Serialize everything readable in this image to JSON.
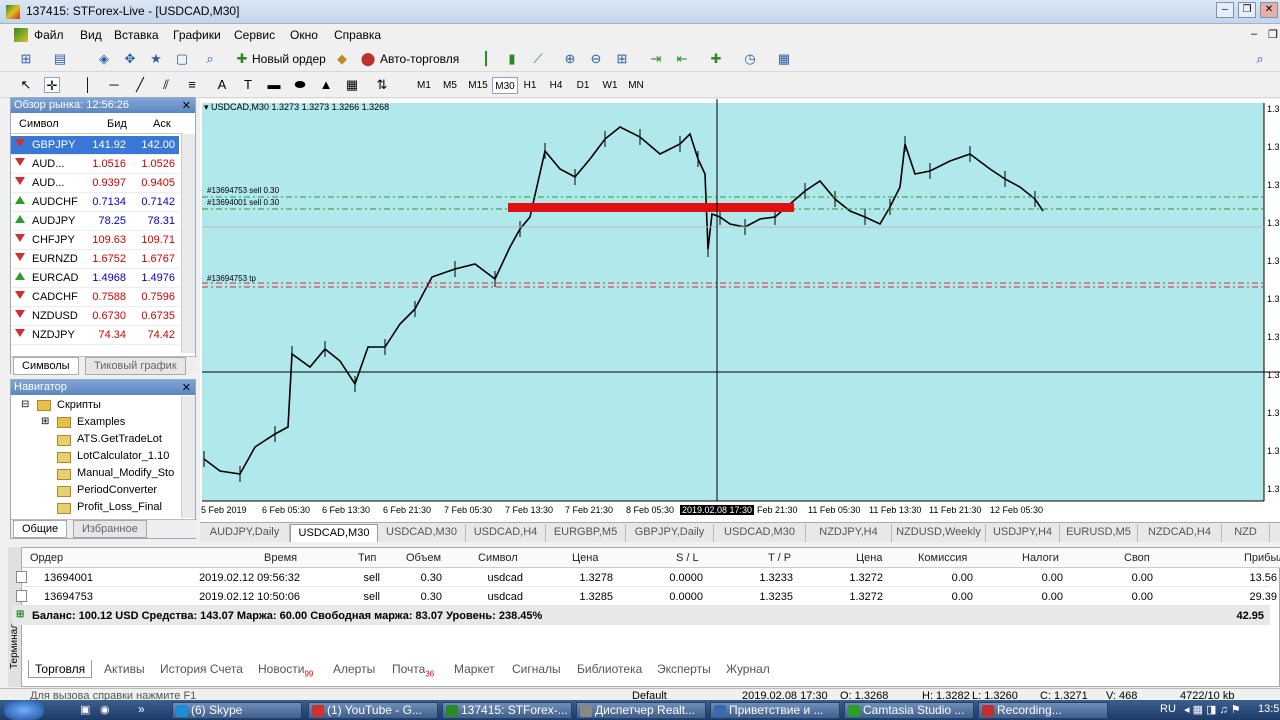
{
  "window": {
    "title": "137415: STForex-Live - [USDCAD,M30]",
    "btn_min": "–",
    "btn_max": "❐",
    "btn_close": "✕"
  },
  "menu": [
    "Файл",
    "Вид",
    "Вставка",
    "Графики",
    "Сервис",
    "Окно",
    "Справка"
  ],
  "toolbar": {
    "new_order": "Новый ордер",
    "auto_trading": "Авто-торговля"
  },
  "timeframes": [
    "M1",
    "M5",
    "M15",
    "M30",
    "H1",
    "H4",
    "D1",
    "W1",
    "MN"
  ],
  "timeframe_active": "M30",
  "market_watch": {
    "title": "Обзор рынка: 12:56:26",
    "col_symbol": "Символ",
    "col_bid": "Бид",
    "col_ask": "Аск",
    "rows": [
      {
        "symbol": "GBPJPY",
        "bid": "141.92",
        "ask": "142.00",
        "dir": "down",
        "selected": true
      },
      {
        "symbol": "AUD...",
        "bid": "1.0516",
        "ask": "1.0526",
        "dir": "down"
      },
      {
        "symbol": "AUD...",
        "bid": "0.9397",
        "ask": "0.9405",
        "dir": "down"
      },
      {
        "symbol": "AUDCHF",
        "bid": "0.7134",
        "ask": "0.7142",
        "dir": "up"
      },
      {
        "symbol": "AUDJPY",
        "bid": "78.25",
        "ask": "78.31",
        "dir": "up"
      },
      {
        "symbol": "CHFJPY",
        "bid": "109.63",
        "ask": "109.71",
        "dir": "down"
      },
      {
        "symbol": "EURNZD",
        "bid": "1.6752",
        "ask": "1.6767",
        "dir": "down"
      },
      {
        "symbol": "EURCAD",
        "bid": "1.4968",
        "ask": "1.4976",
        "dir": "up"
      },
      {
        "symbol": "CADCHF",
        "bid": "0.7588",
        "ask": "0.7596",
        "dir": "down"
      },
      {
        "symbol": "NZDUSD",
        "bid": "0.6730",
        "ask": "0.6735",
        "dir": "down"
      },
      {
        "symbol": "NZDJPY",
        "bid": "74.34",
        "ask": "74.42",
        "dir": "down"
      }
    ],
    "tab_symbols": "Символы",
    "tab_tick": "Тиковый график"
  },
  "navigator": {
    "title": "Навигатор",
    "items": [
      "Скрипты",
      "Examples",
      "ATS.GetTradeLot",
      "LotCalculator_1.10",
      "Manual_Modify_Sto",
      "PeriodConverter",
      "Profit_Loss_Final"
    ],
    "tab_common": "Общие",
    "tab_fav": "Избранное"
  },
  "chart": {
    "header": "USDCAD,M30  1.3273 1.3273 1.3266 1.3268",
    "label_sell1": "#13694753 sell 0.30",
    "label_sell2": "#13694001 sell 0.30",
    "label_tp": "#13694753 tp",
    "x_labels": [
      "5 Feb 2019",
      "6 Feb 05:30",
      "6 Feb 13:30",
      "6 Feb 21:30",
      "7 Feb 05:30",
      "7 Feb 13:30",
      "7 Feb 21:30",
      "8 Feb 05:30",
      "2019.02.08 17:30",
      "Feb 21:30",
      "11 Feb 05:30",
      "11 Feb 13:30",
      "11 Feb 21:30",
      "12 Feb 05:30"
    ],
    "y_labels": [
      "1.3",
      "1.3",
      "1.3",
      "1.3",
      "1.3",
      "1.3",
      "1.3",
      "1.3",
      "1.3",
      "1.3",
      "1.3"
    ]
  },
  "chart_tabs": [
    "AUDJPY,Daily",
    "USDCAD,M30",
    "USDCAD,M30",
    "USDCAD,H4",
    "EURGBP,M5",
    "GBPJPY,Daily",
    "USDCAD,M30",
    "NZDJPY,H4",
    "NZDUSD,Weekly",
    "USDJPY,H4",
    "EURUSD,M5",
    "NZDCAD,H4",
    "NZD"
  ],
  "terminal": {
    "side_label": "Терминал",
    "headers": [
      "Ордер",
      "Время",
      "Тип",
      "Объем",
      "Символ",
      "Цена",
      "S / L",
      "T / P",
      "Цена",
      "Комиссия",
      "Налоги",
      "Своп",
      "Прибыль"
    ],
    "rows": [
      [
        "13694001",
        "2019.02.12 09:56:32",
        "sell",
        "0.30",
        "usdcad",
        "1.3278",
        "0.0000",
        "1.3233",
        "1.3272",
        "0.00",
        "0.00",
        "0.00",
        "13.56"
      ],
      [
        "13694753",
        "2019.02.12 10:50:06",
        "sell",
        "0.30",
        "usdcad",
        "1.3285",
        "0.0000",
        "1.3235",
        "1.3272",
        "0.00",
        "0.00",
        "0.00",
        "29.39"
      ]
    ],
    "balance": "Баланс: 100.12 USD  Средства: 143.07  Маржа: 60.00  Свободная маржа: 83.07  Уровень: 238.45%",
    "total": "42.95",
    "tabs": [
      "Торговля",
      "Активы",
      "История Счета",
      "Новости",
      "Алерты",
      "Почта",
      "Маркет",
      "Сигналы",
      "Библиотека",
      "Эксперты",
      "Журнал"
    ],
    "news_count": "99",
    "mail_count": "36"
  },
  "status": {
    "help": "Для вызова справки нажмите F1",
    "profile": "Default",
    "time": "2019.02.08 17:30",
    "o": "O: 1.3268",
    "h": "H: 1.3282",
    "l": "L: 1.3260",
    "c": "C: 1.3271",
    "v": "V: 468",
    "traffic": "4722/10 kb"
  },
  "taskbar": {
    "items": [
      "(6) Skype",
      "(1) YouTube - G...",
      "137415: STForex-...",
      "Диспетчер Realt...",
      "Приветствие и ...",
      "Camtasia Studio ...",
      "Recording..."
    ],
    "lang": "RU",
    "clock": "13:5"
  },
  "colors": {
    "chart_bg": "#b0e8ec",
    "selected_row": "#3a78d8",
    "order_line": "#e01010"
  }
}
